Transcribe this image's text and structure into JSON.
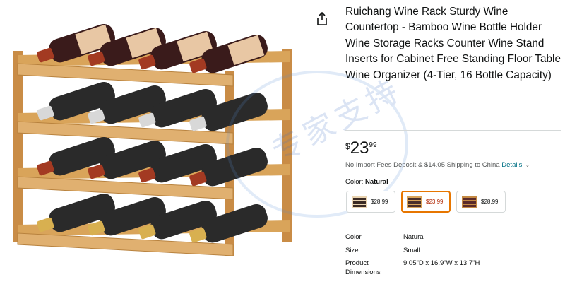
{
  "product": {
    "title": "Ruichang Wine Rack Sturdy Wine Countertop - Bamboo Wine Bottle Holder Wine Storage Racks Counter Wine Stand Inserts for Cabinet Free Standing Floor Table Wine Organizer (4-Tier, 16 Bottle Capacity)",
    "price_symbol": "$",
    "price_whole": "23",
    "price_fraction": "99"
  },
  "shipping": {
    "text": "No Import Fees Deposit & $14.05 Shipping to China",
    "details_link": "Details",
    "chevron": "⌄"
  },
  "color": {
    "label": "Color:",
    "selected": "Natural"
  },
  "swatches": [
    {
      "price": "$28.99",
      "selected": false
    },
    {
      "price": "$23.99",
      "selected": true
    },
    {
      "price": "$28.99",
      "selected": false
    }
  ],
  "specs": [
    {
      "key": "Color",
      "value": "Natural"
    },
    {
      "key": "Size",
      "value": "Small"
    },
    {
      "key": "Product Dimensions",
      "value": "9.05\"D x 16.9\"W x 13.7\"H"
    }
  ],
  "icons": {
    "share": "share-icon"
  },
  "colors": {
    "link": "#007185",
    "selected_border": "#e77600",
    "sale_price": "#b12704",
    "wood": "#d9a45a"
  }
}
